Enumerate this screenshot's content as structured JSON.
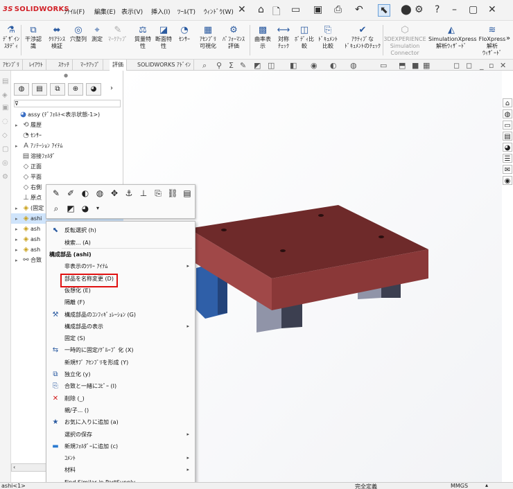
{
  "app": {
    "logo": "SOLIDWORKS",
    "logo_mark": "3S"
  },
  "menubar": [
    "ﾌｧｲﾙ(F)",
    "編集(E)",
    "表示(V)",
    "挿入(I)",
    "ﾂｰﾙ(T)",
    "ｳｨﾝﾄﾞｳ(W)"
  ],
  "ribbon": [
    {
      "name": "design-study",
      "label": "ﾃﾞｻﾞｲﾝ\nｽﾀﾃﾞｨ",
      "icon": "design-study-icon",
      "disabled": false
    },
    {
      "name": "interference",
      "label": "干渉認\n識",
      "icon": "interference-icon",
      "disabled": false
    },
    {
      "name": "clearance",
      "label": "ｸﾘｱﾗﾝｽ\n検証",
      "icon": "clearance-icon",
      "disabled": false
    },
    {
      "name": "hole-align",
      "label": "穴整列",
      "icon": "hole-align-icon",
      "disabled": false
    },
    {
      "name": "measure",
      "label": "測定",
      "icon": "measure-icon",
      "disabled": false
    },
    {
      "name": "markup",
      "label": "ﾏｰｸｱｯﾌﾟ",
      "icon": "markup-icon",
      "disabled": true
    },
    {
      "name": "mass-props",
      "label": "質量特\n性",
      "icon": "mass-icon",
      "disabled": false
    },
    {
      "name": "section-props",
      "label": "断面特\n性",
      "icon": "section-icon",
      "disabled": false
    },
    {
      "name": "sensor",
      "label": "ｾﾝｻｰ",
      "icon": "sensor-icon",
      "disabled": false
    },
    {
      "name": "assembly-vis",
      "label": "ｱｾﾝﾌﾞﾘ\n可視化",
      "icon": "assembly-vis-icon",
      "disabled": false
    },
    {
      "name": "performance",
      "label": "ﾊﾟﾌｫｰﾏﾝｽ\n評価",
      "icon": "performance-icon",
      "disabled": false
    },
    {
      "name": "curvature",
      "label": "曲率表\n示",
      "icon": "curvature-icon",
      "disabled": false
    },
    {
      "name": "symmetry",
      "label": "対称\nﾁｪｯｸ",
      "icon": "symmetry-icon",
      "disabled": false
    },
    {
      "name": "body-compare",
      "label": "ﾎﾞﾃﾞｨ比\n較",
      "icon": "body-compare-icon",
      "disabled": false
    },
    {
      "name": "doc-compare",
      "label": "ﾄﾞｷｭﾒﾝﾄ\n比較",
      "icon": "doc-compare-icon",
      "disabled": false
    },
    {
      "name": "active-doc-check",
      "label": "ｱｸﾃｨﾌﾞな\nﾄﾞｷｭﾒﾝﾄのﾁｪｯｸ",
      "icon": "doc-check-icon",
      "disabled": false
    },
    {
      "name": "3dx-sim",
      "label": "3DEXPERIENCE\nSimulation\nConnector",
      "icon": "3dx-icon",
      "disabled": true
    },
    {
      "name": "simxpress",
      "label": "SimulationXpress\n解析ｳｨｻﾞｰﾄﾞ",
      "icon": "simxpress-icon",
      "disabled": false
    },
    {
      "name": "floxpress",
      "label": "FloXpress\n解析\nｳｨｻﾞｰﾄﾞ",
      "icon": "floxpress-icon",
      "disabled": false
    }
  ],
  "tabs": [
    "ｱｾﾝﾌﾞﾘ",
    "ﾚｲｱｳﾄ",
    "ｽｹｯﾁ",
    "ﾏｰｸｱｯﾌﾟ",
    "評価",
    "SOLIDWORKS ｱﾄﾞｲﾝ"
  ],
  "active_tab": 4,
  "tree": [
    {
      "label": "assy  (ﾃﾞﾌｫﾙﾄ<表示状態-1>)",
      "icon": "assembly-icon",
      "arrow": "",
      "indent": 0
    },
    {
      "label": "履歴",
      "icon": "history-icon",
      "arrow": "▸",
      "indent": 1
    },
    {
      "label": "ｾﾝｻｰ",
      "icon": "sensor-icon",
      "arrow": "",
      "indent": 1
    },
    {
      "label": "ｱﾉﾃｰｼｮﾝ ｱｲﾃﾑ",
      "icon": "annotation-icon",
      "arrow": "▸",
      "indent": 1
    },
    {
      "label": "溶接ﾌｫﾙﾀﾞ",
      "icon": "weld-folder-icon",
      "arrow": "",
      "indent": 1
    },
    {
      "label": "正面",
      "icon": "plane-icon",
      "arrow": "",
      "indent": 1
    },
    {
      "label": "平面",
      "icon": "plane-icon",
      "arrow": "",
      "indent": 1
    },
    {
      "label": "右側",
      "icon": "plane-icon",
      "arrow": "",
      "indent": 1
    },
    {
      "label": "原点",
      "icon": "origin-icon",
      "arrow": "",
      "indent": 1
    },
    {
      "label": "(固定",
      "icon": "part-icon",
      "arrow": "▸",
      "indent": 1
    },
    {
      "label": "ashi",
      "icon": "part-icon",
      "arrow": "▸",
      "indent": 1,
      "selected": true
    },
    {
      "label": "ash",
      "icon": "part-icon",
      "arrow": "▸",
      "indent": 1
    },
    {
      "label": "ash",
      "icon": "part-icon",
      "arrow": "▸",
      "indent": 1
    },
    {
      "label": "ash",
      "icon": "part-icon",
      "arrow": "▸",
      "indent": 1
    },
    {
      "label": "合致",
      "icon": "mate-icon",
      "arrow": "▸",
      "indent": 1
    }
  ],
  "context_toolbar": {
    "row1": [
      "edit-sketch-icon",
      "edit-feature-icon",
      "hide-icon",
      "transparency-icon",
      "move-icon",
      "fix-icon",
      "normal-to-icon",
      "attach-icon",
      "link-icon",
      "table-icon"
    ],
    "row2": [
      "zoom-icon",
      "section-view-icon",
      "appearance-icon"
    ]
  },
  "context_menu": {
    "items": [
      {
        "label": "反転選択 (h)",
        "icon": "select-cursor-icon",
        "submenu": false,
        "kind": "item"
      },
      {
        "label": "検索... (A)",
        "icon": "",
        "submenu": false,
        "kind": "item"
      },
      {
        "label": "構成部品 (ashi)",
        "icon": "",
        "submenu": false,
        "kind": "header"
      },
      {
        "label": "非表示のﾂﾘｰ ｱｲﾃﾑ",
        "icon": "",
        "submenu": true,
        "kind": "item"
      },
      {
        "label": "部品を名称変更 (D)",
        "icon": "",
        "submenu": false,
        "kind": "item"
      },
      {
        "label": "仮想化 (E)",
        "icon": "",
        "submenu": false,
        "kind": "item"
      },
      {
        "label": "隔離 (F)",
        "icon": "",
        "submenu": false,
        "kind": "item"
      },
      {
        "label": "構成部品のｺﾝﾌｨｷﾞｭﾚｰｼｮﾝ (G)",
        "icon": "configuration-icon",
        "submenu": false,
        "kind": "item"
      },
      {
        "label": "構成部品の表示",
        "icon": "",
        "submenu": true,
        "kind": "item"
      },
      {
        "label": "固定 (S)",
        "icon": "",
        "submenu": false,
        "kind": "item"
      },
      {
        "label": "一時的に固定/ｸﾞﾙｰﾌﾟ 化 (X)",
        "icon": "temp-fix-icon",
        "submenu": false,
        "kind": "item"
      },
      {
        "label": "新規ｻﾌﾞ ｱｾﾝﾌﾞﾘを形成 (Y)",
        "icon": "",
        "submenu": false,
        "kind": "item"
      },
      {
        "label": "独立化 (y)",
        "icon": "independent-icon",
        "submenu": false,
        "kind": "item"
      },
      {
        "label": "合致と一緒にｺﾋﾟｰ (I)",
        "icon": "copy-mates-icon",
        "submenu": false,
        "kind": "item"
      },
      {
        "label": "削除 (_)",
        "icon": "delete-x-icon",
        "submenu": false,
        "kind": "item"
      },
      {
        "label": "親/子... ()",
        "icon": "",
        "submenu": false,
        "kind": "item"
      },
      {
        "label": "お気に入りに追加 (a)",
        "icon": "favorite-icon",
        "submenu": false,
        "kind": "item"
      },
      {
        "label": "選択の保存",
        "icon": "",
        "submenu": true,
        "kind": "item"
      },
      {
        "label": "新規ﾌｫﾙﾀﾞｰに追加 (c)",
        "icon": "folder-icon",
        "submenu": false,
        "kind": "item"
      },
      {
        "label": "ｺﾒﾝﾄ",
        "icon": "",
        "submenu": true,
        "kind": "item"
      },
      {
        "label": "材料",
        "icon": "",
        "submenu": true,
        "kind": "item"
      },
      {
        "label": "Find Similar in PartSupply",
        "icon": "",
        "submenu": false,
        "kind": "item"
      }
    ],
    "highlighted": "部品を名称変更 (D)"
  },
  "statusbar": {
    "left": "ashi<1>",
    "center": "完全定義",
    "units": "MMGS"
  },
  "colors": {
    "plate": "#a04848",
    "plate_top": "#6e2a2a",
    "plate_side": "#8a3838",
    "leg_gray": "#8a8fa3",
    "leg_blue": "#2f5fa8",
    "highlight": "#e01010",
    "selection": "#cfe4fb"
  }
}
